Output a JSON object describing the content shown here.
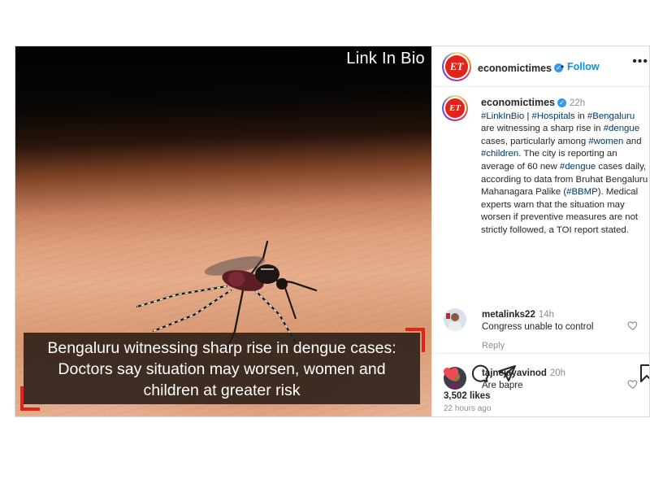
{
  "media": {
    "link_in_bio": "Link In Bio",
    "headline": "Bengaluru witnessing sharp rise in dengue cases: Doctors say situation may worsen, women and children at greater risk"
  },
  "header": {
    "avatar_text": "ET",
    "username": "economictimes",
    "separator": "•",
    "follow_label": "Follow",
    "more_label": "•••"
  },
  "caption": {
    "username": "economictimes",
    "time": "22h",
    "parts": [
      {
        "t": "#LinkInBio",
        "tag": true
      },
      {
        "t": " | ",
        "tag": false
      },
      {
        "t": "#Hospitals",
        "tag": true
      },
      {
        "t": " in ",
        "tag": false
      },
      {
        "t": "#Bengaluru",
        "tag": true
      },
      {
        "t": " are witnessing a sharp rise in ",
        "tag": false
      },
      {
        "t": "#dengue",
        "tag": true
      },
      {
        "t": " cases, particularly among ",
        "tag": false
      },
      {
        "t": "#women",
        "tag": true
      },
      {
        "t": " and ",
        "tag": false
      },
      {
        "t": "#children",
        "tag": true
      },
      {
        "t": ". The city is reporting an average of 60 new ",
        "tag": false
      },
      {
        "t": "#dengue",
        "tag": true
      },
      {
        "t": " cases daily, according to data from Bruhat Bengaluru Mahanagara Palike (",
        "tag": false
      },
      {
        "t": "#BBMP",
        "tag": true
      },
      {
        "t": "). Medical experts warn that the situation may worsen if preventive measures are not strictly followed, a TOI report stated.",
        "tag": false
      }
    ]
  },
  "comments": [
    {
      "username": "metalinks22",
      "time": "14h",
      "text": "Congress unable to control",
      "reply_label": "Reply"
    },
    {
      "username": "tajnejayavinod",
      "time": "20h",
      "text": "Are bapre"
    }
  ],
  "actions": {
    "likes": "3,502 likes",
    "posted_ago": "22 hours ago"
  },
  "colors": {
    "brand_red": "#e2231a",
    "link_blue": "#0095f6",
    "hashtag": "#00376b",
    "like_red": "#ed4956"
  }
}
